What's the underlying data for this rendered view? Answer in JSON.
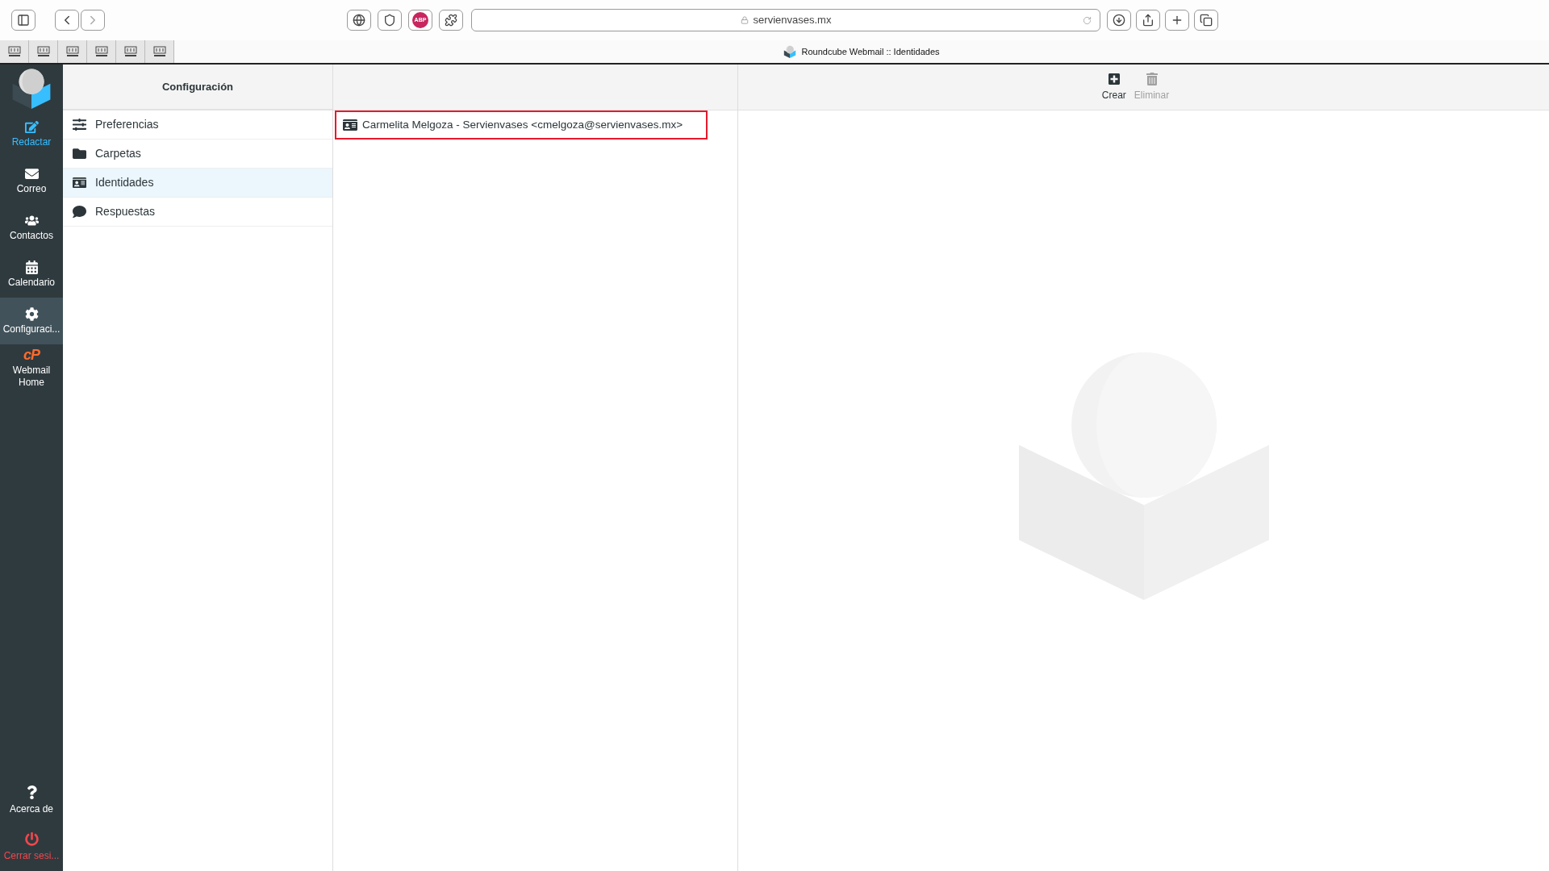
{
  "browser": {
    "abp_label": "ABP",
    "address": "servienvases.mx",
    "pinned_tabs": [
      {
        "kind": "favicon"
      },
      {
        "kind": "favicon"
      },
      {
        "kind": "favicon"
      },
      {
        "kind": "favicon"
      },
      {
        "kind": "favicon"
      },
      {
        "kind": "favicon"
      }
    ],
    "page_title": "Roundcube Webmail :: Identidades"
  },
  "nav": {
    "items": [
      {
        "kind": "compose",
        "label": "Redactar",
        "color": "#37beff",
        "selected": false
      },
      {
        "kind": "mail",
        "label": "Correo",
        "color": "#ffffff",
        "selected": false
      },
      {
        "kind": "contacts",
        "label": "Contactos",
        "color": "#ffffff",
        "selected": false
      },
      {
        "kind": "calendar",
        "label": "Calendario",
        "color": "#ffffff",
        "selected": false
      },
      {
        "kind": "settings",
        "label": "Configuraci...",
        "color": "#ffffff",
        "selected": true
      },
      {
        "kind": "cpanel",
        "logo_text": "cP",
        "label": "Webmail Home",
        "color": "#ffffff",
        "selected": false
      }
    ],
    "bottom_items": [
      {
        "kind": "about",
        "label": "Acerca de",
        "color": "#ffffff"
      },
      {
        "kind": "logout",
        "label": "Cerrar sesi...",
        "color": "#f0484c"
      }
    ]
  },
  "settings": {
    "title": "Configuración",
    "items": [
      {
        "kind": "preferences",
        "label": "Preferencias",
        "selected": false
      },
      {
        "kind": "folders",
        "label": "Carpetas",
        "selected": false
      },
      {
        "kind": "identities",
        "label": "Identidades",
        "selected": true
      },
      {
        "kind": "responses",
        "label": "Respuestas",
        "selected": false
      }
    ]
  },
  "identities": [
    {
      "label": "Carmelita Melgoza - Servienvases <cmelgoza@servienvases.mx>",
      "highlighted": true
    }
  ],
  "toolbar": [
    {
      "kind": "create",
      "label": "Crear",
      "disabled": false
    },
    {
      "kind": "delete",
      "label": "Eliminar",
      "disabled": true
    }
  ]
}
